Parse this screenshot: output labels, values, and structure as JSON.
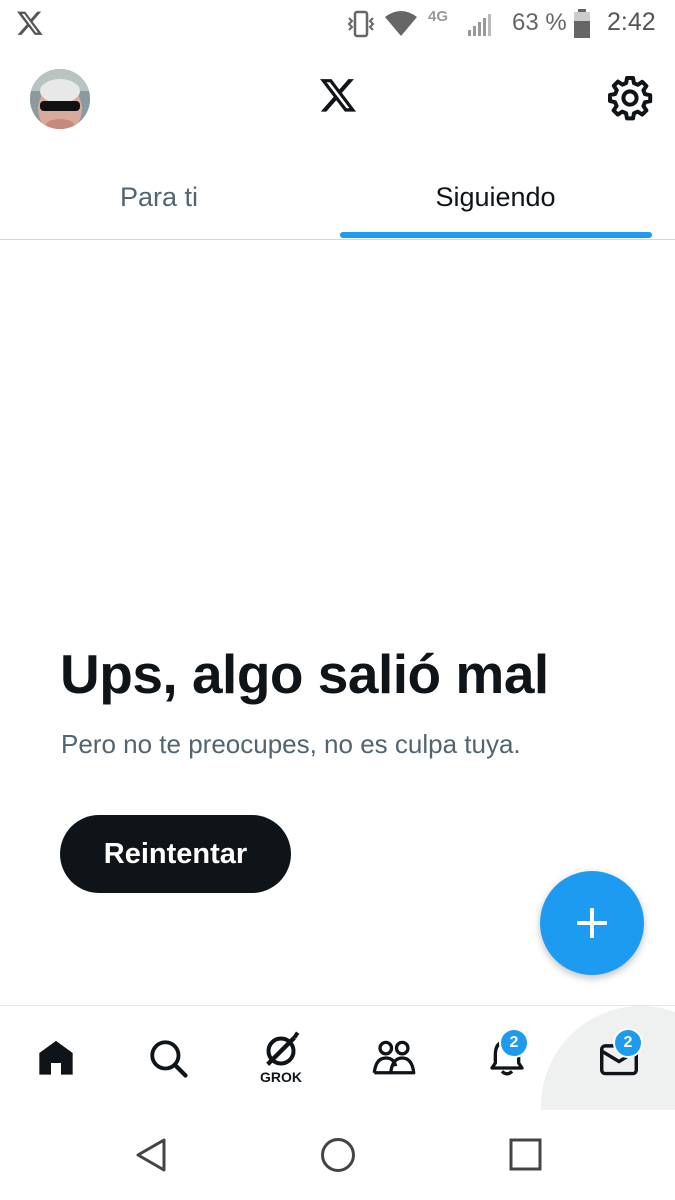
{
  "status_bar": {
    "network": "4G",
    "battery": "63 %",
    "time": "2:42"
  },
  "header": {
    "logo": "x-logo",
    "settings_icon": "gear-icon"
  },
  "tabs": [
    {
      "label": "Para ti",
      "active": false
    },
    {
      "label": "Siguiendo",
      "active": true
    }
  ],
  "error": {
    "title": "Ups, algo salió mal",
    "message": "Pero no te preocupes, no es culpa tuya.",
    "retry_label": "Reintentar"
  },
  "bottom_nav": {
    "grok_label": "GROK",
    "notifications_badge": "2",
    "messages_badge": "2"
  },
  "colors": {
    "accent": "#1d9bf0",
    "text_primary": "#0f1419",
    "text_secondary": "#536471"
  }
}
